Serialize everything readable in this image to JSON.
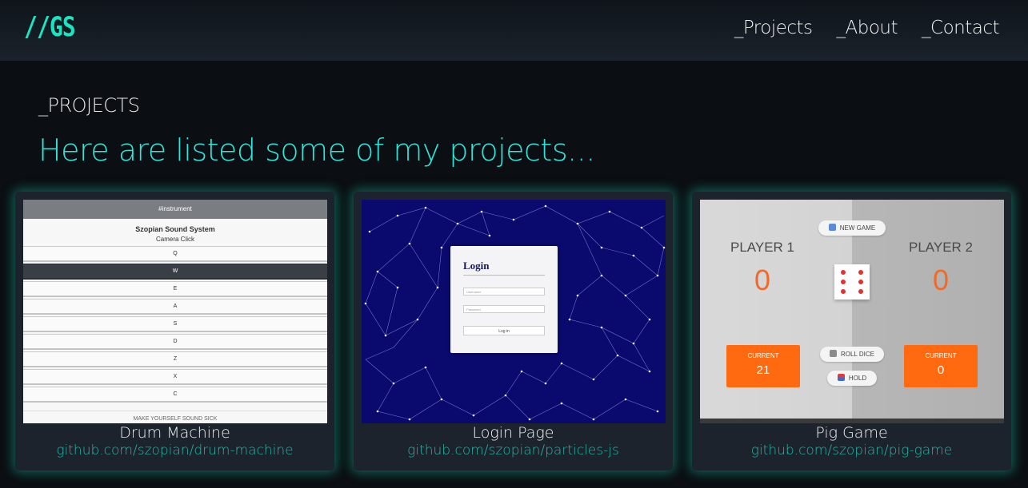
{
  "header": {
    "logo": "//GS",
    "nav": [
      "_Projects",
      "_About",
      "_Contact"
    ]
  },
  "section": {
    "label": "_PROJECTS",
    "title": "Here are listed some of my projects..."
  },
  "projects": [
    {
      "name": "Drum Machine",
      "link": "github.com/szopian/drum-machine",
      "preview": {
        "header": "#instrument",
        "title": "Szopian Sound System",
        "subtitle": "Camera Click",
        "keys": [
          "Q",
          "W",
          "E",
          "A",
          "S",
          "D",
          "Z",
          "X",
          "C"
        ],
        "active_key": "W",
        "footer": "MAKE YOURSELF SOUND SICK"
      }
    },
    {
      "name": "Login Page",
      "link": "github.com/szopian/particles-js",
      "preview": {
        "title": "Login",
        "username_placeholder": "Username",
        "password_placeholder": "Password",
        "button": "Log in"
      }
    },
    {
      "name": "Pig Game",
      "link": "github.com/szopian/pig-game",
      "preview": {
        "new_game": "NEW GAME",
        "player1": "PLAYER 1",
        "player2": "PLAYER 2",
        "score1": "0",
        "score2": "0",
        "current_label": "CURRENT",
        "current1": "21",
        "current2": "0",
        "roll": "ROLL DICE",
        "hold": "HOLD"
      }
    }
  ],
  "colors": {
    "accent": "#19e6c1",
    "title": "#2ee6d8",
    "link": "#27b6a8",
    "card_bg": "#1c232c",
    "page_bg": "#0b0e12",
    "pig_orange": "#ff6a10"
  }
}
